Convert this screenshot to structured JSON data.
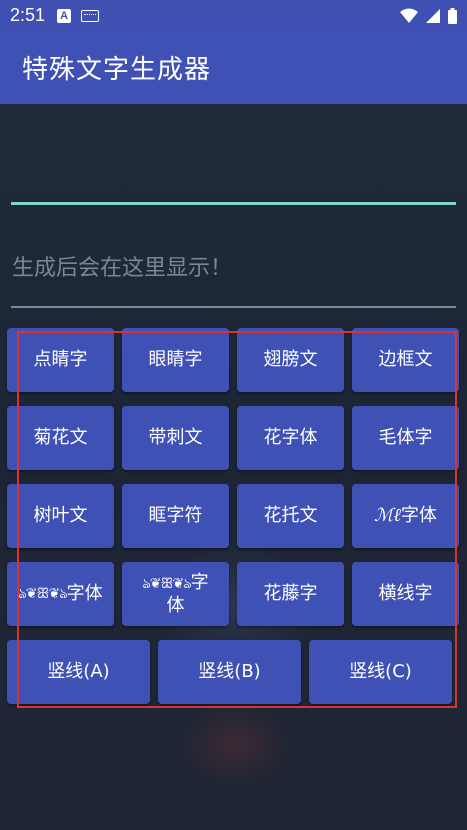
{
  "status_bar": {
    "time": "2:51",
    "notification_badge": "A",
    "icons": [
      "a-notification-icon",
      "keyboard-icon",
      "wifi-icon",
      "signal-icon",
      "battery-icon"
    ]
  },
  "app_bar": {
    "title": "特殊文字生成器"
  },
  "input": {
    "value": ""
  },
  "output": {
    "placeholder": "生成后会在这里显示！"
  },
  "buttons": {
    "row1": [
      "点睛字",
      "眼睛字",
      "翅膀文",
      "边框文"
    ],
    "row2": [
      "菊花文",
      "带刺文",
      "花字体",
      "毛体字"
    ],
    "row3": [
      "树叶文",
      "眶字符",
      "花托文",
      "字体"
    ],
    "row3_deco": "ℳℓ",
    "row4": [
      "字体",
      "字体",
      "花藤字",
      "横线字"
    ],
    "row4_deco_1": "ঌ❦ꕥ❦ঌ",
    "row4_deco_2_prefix": "ঌ❦ꕥ❦ঌ",
    "row4_deco_2_suffix": "字",
    "row4_deco_2_line2": "体",
    "row5": [
      "竖线(A)",
      "竖线(B)",
      "竖线(C)"
    ]
  },
  "colors": {
    "primary": "#3f51b5",
    "status_bar": "#3f4fb2",
    "background": "#202838",
    "input_underline": "#7fd6c8",
    "highlight_border": "#d93434"
  }
}
